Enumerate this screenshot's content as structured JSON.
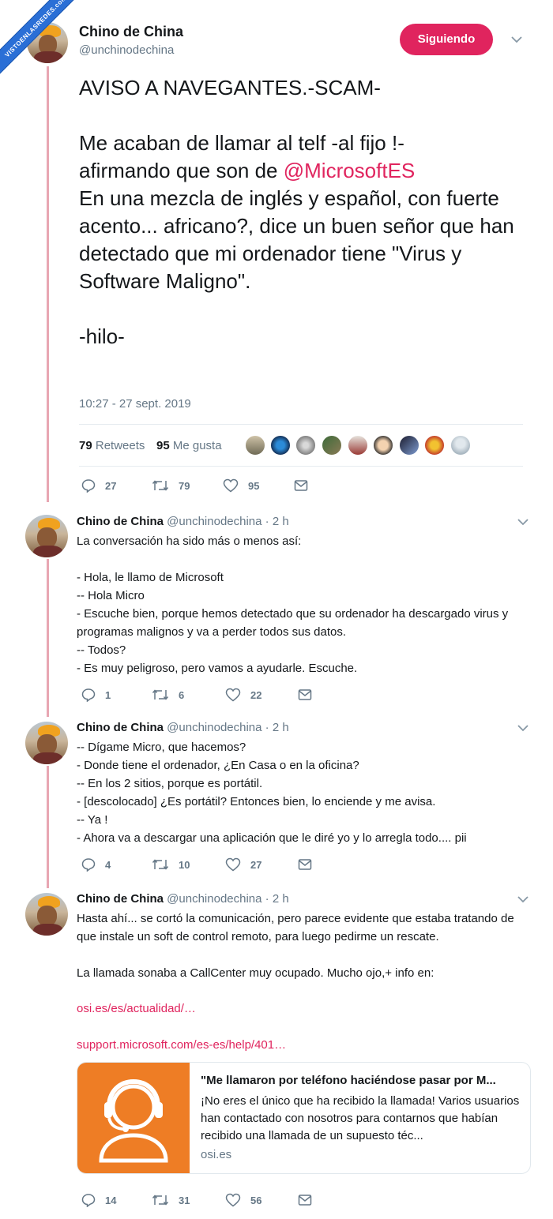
{
  "watermark": "VISTOENLASREDES.com",
  "main_tweet": {
    "author_name": "Chino de China",
    "author_handle": "@unchinodechina",
    "follow_label": "Siguiendo",
    "text_before_mention": "AVISO A NAVEGANTES.-SCAM-\n\nMe acaban de llamar al telf -al fijo !-\nafirmando que son de ",
    "mention": "@MicrosoftES",
    "text_after_mention": "\nEn una mezcla de inglés y español, con fuerte acento... africano?, dice un buen señor que han detectado que mi ordenador tiene \"Virus y Software Maligno\".\n\n-hilo-",
    "timestamp": "10:27 - 27 sept. 2019",
    "retweets_count": "79",
    "retweets_label": "Retweets",
    "likes_count": "95",
    "likes_label": "Me gusta",
    "actions": {
      "reply": "27",
      "retweet": "79",
      "like": "95"
    }
  },
  "replies": [
    {
      "name": "Chino de China",
      "handle": "@unchinodechina",
      "time": "· 2 h",
      "text": "La conversación ha sido más o menos así:\n\n- Hola, le llamo de Microsoft\n-- Hola Micro\n- Escuche bien, porque hemos detectado que su ordenador ha descargado virus y programas malignos y va a perder todos sus datos.\n-- Todos?\n- Es muy peligroso, pero vamos a ayudarle. Escuche.",
      "actions": {
        "reply": "1",
        "retweet": "6",
        "like": "22"
      }
    },
    {
      "name": "Chino de China",
      "handle": "@unchinodechina",
      "time": "· 2 h",
      "text": "-- Dígame Micro, que hacemos?\n- Donde tiene el ordenador, ¿En Casa o en la oficina?\n-- En los 2 sitios, porque es portátil.\n- [descolocado] ¿Es portátil? Entonces bien, lo enciende y me avisa.\n-- Ya !\n- Ahora va a descargar una aplicación que le diré yo y lo arregla todo.... pii",
      "actions": {
        "reply": "4",
        "retweet": "10",
        "like": "27"
      }
    },
    {
      "name": "Chino de China",
      "handle": "@unchinodechina",
      "time": "· 2 h",
      "text": "Hasta ahí... se cortó la comunicación, pero parece evidente que estaba tratando de que instale un soft de control remoto, para luego pedirme un rescate.\n\nLa llamada sonaba a CallCenter muy ocupado. Mucho ojo,+ info en:",
      "link1": "osi.es/es/actualidad/…",
      "link2": "support.microsoft.com/es-es/help/401…",
      "card": {
        "title": "\"Me llamaron por teléfono haciéndose pasar por M...",
        "description": "¡No eres el único que ha recibido la llamada! Varios usuarios han contactado con nosotros para contarnos que habían recibido una llamada de un supuesto téc...",
        "domain": "osi.es"
      },
      "actions": {
        "reply": "14",
        "retweet": "31",
        "like": "56"
      }
    }
  ],
  "colors": {
    "accent": "#e0245e",
    "secondary_text": "#657786",
    "thread_line": "#e8a6b2",
    "card_image": "#ee7d25"
  },
  "icons": [
    "reply-icon",
    "retweet-icon",
    "like-icon",
    "message-icon",
    "chevron-down-icon",
    "headset-person-icon"
  ]
}
